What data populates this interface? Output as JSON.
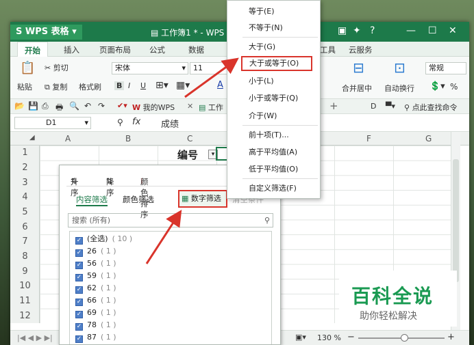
{
  "app": {
    "logo": "WPS 表格",
    "logo_mark": "S",
    "doc_title": "工作簿1 * - WPS"
  },
  "window_controls": [
    "▣",
    "✦",
    "?",
    "—",
    "⊡",
    "—",
    "☐",
    "✕"
  ],
  "tabs": [
    "开始",
    "插入",
    "页面布局",
    "公式",
    "数据",
    "工具",
    "云服务"
  ],
  "ribbon": {
    "paste": "粘贴",
    "cut": "剪切",
    "copy": "复制",
    "format_painter": "格式刷",
    "font_name": "宋体",
    "font_size": "11",
    "bold": "B",
    "italic": "I",
    "underline": "U",
    "merge_center": "合并居中",
    "wrap_text": "自动换行",
    "number_format": "常规",
    "percent": "%"
  },
  "quickbar": {
    "mywps": "我的WPS",
    "workbook_tab": "工作",
    "add": "+",
    "search_cmd": "点此查找命令"
  },
  "formula_bar": {
    "name_box": "D1",
    "fx": "fx",
    "value": "成绩"
  },
  "columns": [
    "A",
    "B",
    "C",
    "F",
    "G"
  ],
  "rows": [
    "1",
    "2",
    "3",
    "4",
    "5",
    "6",
    "7",
    "8",
    "9",
    "10",
    "11",
    "12"
  ],
  "cell_header": "编号",
  "panel": {
    "sort_asc": "升序",
    "sort_desc": "降序",
    "color_sort": "颜色排序",
    "content_filter": "内容筛选",
    "color_filter": "颜色筛选",
    "number_filter": "数字筛选",
    "clear": "清空条件",
    "search_placeholder": "搜索 (所有)",
    "items": [
      {
        "label": "(全选)",
        "count": "( 10 )"
      },
      {
        "label": "26",
        "count": "( 1 )"
      },
      {
        "label": "56",
        "count": "( 1 )"
      },
      {
        "label": "59",
        "count": "( 1 )"
      },
      {
        "label": "62",
        "count": "( 1 )"
      },
      {
        "label": "66",
        "count": "( 1 )"
      },
      {
        "label": "69",
        "count": "( 1 )"
      },
      {
        "label": "78",
        "count": "( 1 )"
      },
      {
        "label": "87",
        "count": "( 1 )"
      }
    ]
  },
  "menu": {
    "items": [
      "等于(E)",
      "不等于(N)",
      "大于(G)",
      "大于或等于(O)",
      "小于(L)",
      "小于或等于(Q)",
      "介于(W)",
      "前十项(T)...",
      "高于平均值(A)",
      "低于平均值(O)",
      "自定义筛选(F)"
    ],
    "highlight_index": 3
  },
  "status": {
    "zoom": "130 %"
  },
  "watermark": {
    "title": "百科全说",
    "subtitle": "助你轻松解决"
  },
  "colors": {
    "accent": "#1d7a4a",
    "highlight": "#d9342b"
  }
}
